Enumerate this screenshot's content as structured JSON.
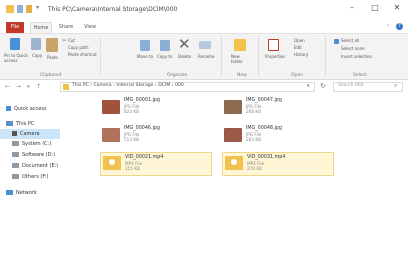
{
  "window": {
    "title": "This PC\\Camera\\Internal Storage\\DCIM\\000",
    "minimize": "–",
    "maximize": "□",
    "close": "✕",
    "help": "?"
  },
  "menu_tabs": [
    "File",
    "Home",
    "Share",
    "View"
  ],
  "ribbon": {
    "clipboard": {
      "pin_label": "Pin to Quick access",
      "copy_label": "Copy",
      "paste_label": "Paste",
      "cut_label": "Cut",
      "copy_path_label": "Copy path",
      "paste_shortcut_label": "Paste shortcut",
      "group_label": "Clipboard"
    },
    "organize": {
      "move_to_label": "Move to",
      "copy_to_label": "Copy to",
      "delete_label": "Delete",
      "rename_label": "Rename",
      "group_label": "Organize"
    },
    "new": {
      "new_folder_label": "New folder",
      "group_label": "New"
    },
    "open": {
      "properties_label": "Properties",
      "open_label": "Open",
      "edit_label": "Edit",
      "history_label": "History",
      "group_label": "Open"
    },
    "select": {
      "select_all_label": "Select all",
      "select_none_label": "Select none",
      "invert_label": "Invert selection",
      "group_label": "Select"
    }
  },
  "address": {
    "path": "This PC  ›  Camera  ›  Internal Storage  ›  DCIM  ›  000",
    "search_placeholder": "Search 000"
  },
  "nav_pane": [
    {
      "label": "Quick access",
      "icon": "star-icon"
    },
    {
      "label": "This PC",
      "icon": "computer-icon"
    },
    {
      "label": "Camera",
      "icon": "camera-icon"
    },
    {
      "label": "System (C:)",
      "icon": "drive-icon"
    },
    {
      "label": "Software (D:)",
      "icon": "drive-icon"
    },
    {
      "label": "Document (E:)",
      "icon": "drive-icon"
    },
    {
      "label": "Others (F:)",
      "icon": "drive-icon"
    },
    {
      "label": "Network",
      "icon": "network-icon"
    }
  ],
  "files": [
    {
      "name": "IMG_00001.jpg",
      "type": "JPG File",
      "size": "823 KB",
      "kind": "image"
    },
    {
      "name": "IMG_00047.jpg",
      "type": "JPG File",
      "size": "268 KB",
      "kind": "image"
    },
    {
      "name": "IMG_00046.jpg",
      "type": "JPG File",
      "size": "513 KB",
      "kind": "image"
    },
    {
      "name": "IMG_00048.jpg",
      "type": "JPG File",
      "size": "283 KB",
      "kind": "image"
    },
    {
      "name": "VID_00021.mp4",
      "type": "MP4 File",
      "size": "255 KB",
      "kind": "video"
    },
    {
      "name": "VID_00031.mp4",
      "type": "MP4 File",
      "size": "270 KB",
      "kind": "video"
    }
  ],
  "colors": {
    "file_tab": "#c0392b",
    "selected_nav": "#cce4f7",
    "video_thumb": "#f2c14e"
  }
}
